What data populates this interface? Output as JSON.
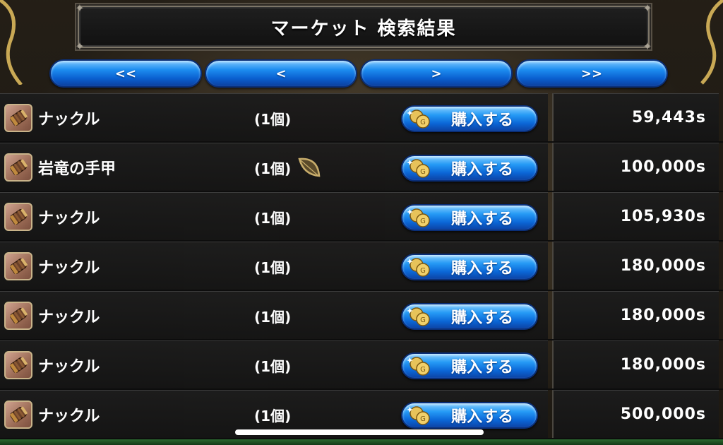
{
  "header": {
    "title": "マーケット 検索結果"
  },
  "pager": [
    {
      "label": "<<"
    },
    {
      "label": "<"
    },
    {
      "label": ">"
    },
    {
      "label": ">>"
    }
  ],
  "rows": [
    {
      "name": "ナックル",
      "qty": "(1個)",
      "buy": "購入する",
      "price": "59,443s",
      "extra_icon": ""
    },
    {
      "name": "岩竜の手甲",
      "qty": "(1個)",
      "buy": "購入する",
      "price": "100,000s",
      "extra_icon": "leaf-icon"
    },
    {
      "name": "ナックル",
      "qty": "(1個)",
      "buy": "購入する",
      "price": "105,930s",
      "extra_icon": ""
    },
    {
      "name": "ナックル",
      "qty": "(1個)",
      "buy": "購入する",
      "price": "180,000s",
      "extra_icon": ""
    },
    {
      "name": "ナックル",
      "qty": "(1個)",
      "buy": "購入する",
      "price": "180,000s",
      "extra_icon": ""
    },
    {
      "name": "ナックル",
      "qty": "(1個)",
      "buy": "購入する",
      "price": "180,000s",
      "extra_icon": ""
    },
    {
      "name": "ナックル",
      "qty": "(1個)",
      "buy": "購入する",
      "price": "500,000s",
      "extra_icon": ""
    }
  ],
  "colors": {
    "button_blue": "#1d8df0",
    "row_bg": "#1c1c1c"
  },
  "icons": {
    "item": "knuckle-icon",
    "buy": "coin-icon"
  }
}
